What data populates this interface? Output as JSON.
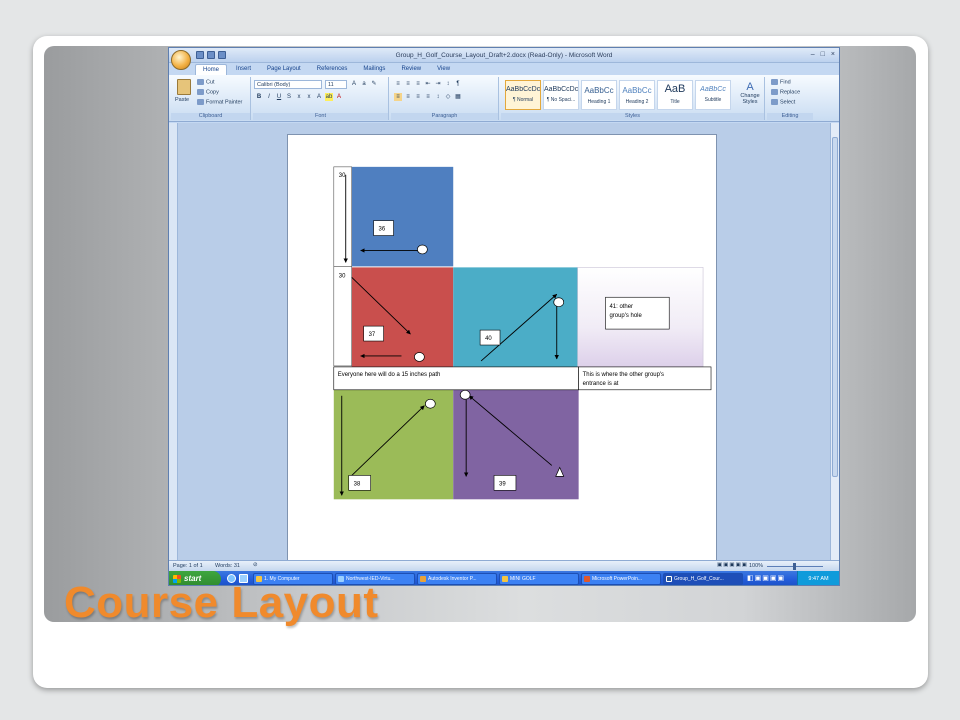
{
  "slide": {
    "title": "Course Layout"
  },
  "window": {
    "title": "Group_H_Golf_Course_Layout_Draft+2.docx (Read-Only) - Microsoft Word",
    "controls": [
      "–",
      "□",
      "×"
    ]
  },
  "ribbon": {
    "tabs": [
      "Home",
      "Insert",
      "Page Layout",
      "References",
      "Mailings",
      "Review",
      "View"
    ],
    "active_tab": "Home",
    "clipboard": {
      "paste": "Paste",
      "cut": "Cut",
      "copy": "Copy",
      "format_painter": "Format Painter",
      "label": "Clipboard"
    },
    "font": {
      "family": "Calibri (Body)",
      "size": "11",
      "label": "Font"
    },
    "paragraph": {
      "label": "Paragraph"
    },
    "styles": {
      "items": [
        {
          "sample": "AaBbCcDc",
          "name": "¶ Normal"
        },
        {
          "sample": "AaBbCcDc",
          "name": "¶ No Spaci..."
        },
        {
          "sample": "AaBbCc",
          "name": "Heading 1"
        },
        {
          "sample": "AaBbCc",
          "name": "Heading 2"
        },
        {
          "sample": "AaB",
          "name": "Title"
        },
        {
          "sample": "AaBbCc",
          "name": "Subtitle"
        }
      ],
      "change_styles": "Change Styles",
      "label": "Styles"
    },
    "editing": {
      "find": "Find",
      "replace": "Replace",
      "select": "Select",
      "label": "Editing"
    }
  },
  "document": {
    "box_30_top": "30",
    "box_30_mid": "30",
    "hole_36": "36",
    "hole_37": "37",
    "hole_38": "38",
    "hole_39": "39",
    "hole_40": "40",
    "hole_41": "41: other group's hole",
    "note_path": "Everyone here will do a 15 inches path",
    "note_entrance": "This is where the other group's entrance is at",
    "colors": {
      "tile36": "#4f7fc0",
      "tile37": "#c94f4d",
      "tile40": "#4badc7",
      "tile38": "#9bbb58",
      "tile39": "#8064a2"
    }
  },
  "status": {
    "page": "Page: 1 of 1",
    "words": "Words: 31",
    "zoom": "100%"
  },
  "taskbar": {
    "start": "start",
    "tasks": [
      "1. My Computer",
      "Northwest-IED-Virtu...",
      "Autodesk Inventor P...",
      "MINI GOLF",
      "Microsoft PowerPoin...",
      "Group_H_Golf_Cour..."
    ],
    "clock": "9:47 AM"
  }
}
